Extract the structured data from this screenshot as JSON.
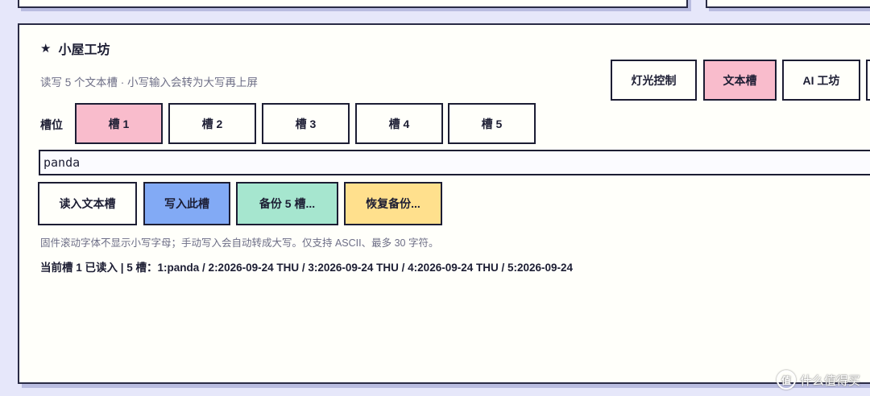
{
  "panel": {
    "title": "小屋工坊",
    "title_icon": "star-icon",
    "subtitle": "读写 5 个文本槽 · 小写输入会转为大写再上屏"
  },
  "nav": {
    "items": [
      {
        "label": "灯光控制",
        "active": false
      },
      {
        "label": "文本槽",
        "active": true
      },
      {
        "label": "AI 工坊",
        "active": false
      }
    ]
  },
  "slots": {
    "label": "槽位",
    "items": [
      {
        "label": "槽 1",
        "active": true
      },
      {
        "label": "槽 2",
        "active": false
      },
      {
        "label": "槽 3",
        "active": false
      },
      {
        "label": "槽 4",
        "active": false
      },
      {
        "label": "槽 5",
        "active": false
      }
    ]
  },
  "input": {
    "value": "panda"
  },
  "actions": {
    "read_label": "读入文本槽",
    "write_label": "写入此槽",
    "backup_label": "备份 5 槽...",
    "restore_label": "恢复备份..."
  },
  "note": "固件滚动字体不显示小写字母；手动写入会自动转成大写。仅支持 ASCII、最多 30 字符。",
  "status": "当前槽 1 已读入  |  5 槽：1:panda / 2:2026-09-24 THU / 3:2026-09-24 THU / 4:2026-09-24 THU / 5:2026-09-24",
  "watermark": {
    "glyph": "值",
    "text": "什么值得买"
  },
  "colors": {
    "active_pink": "#f9bccc",
    "write_blue": "#82aaf5",
    "backup_green": "#a6e6cf",
    "restore_yellow": "#ffe08d",
    "border": "#1c1d33",
    "page_bg": "#e6e7fa",
    "card_bg": "#fffffa"
  }
}
